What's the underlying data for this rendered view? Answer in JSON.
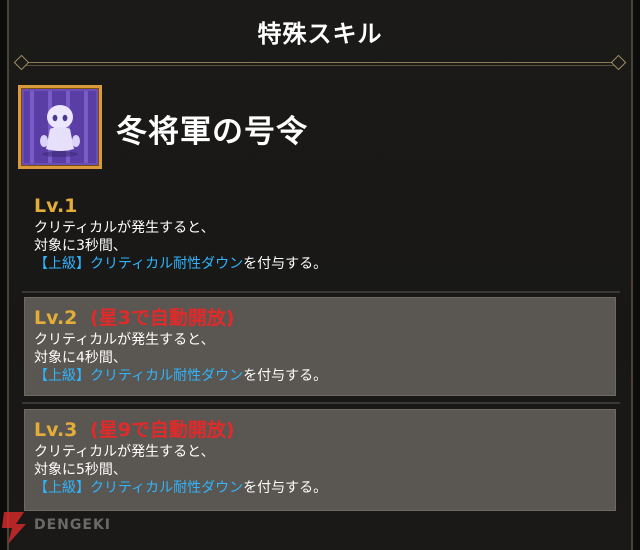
{
  "header": {
    "title": "特殊スキル"
  },
  "skill": {
    "name": "冬将軍の号令",
    "icon": "snowman-ghost-icon"
  },
  "levels": [
    {
      "level": "Lv.1",
      "condition": "",
      "line1": "クリティカルが発生すると、",
      "line2": "対象に3秒間、",
      "keyword": "【上級】クリティカル耐性ダウン",
      "suffix": "を付与する。"
    },
    {
      "level": "Lv.2",
      "condition": "(星3で自動開放)",
      "line1": "クリティカルが発生すると、",
      "line2": "対象に4秒間、",
      "keyword": "【上級】クリティカル耐性ダウン",
      "suffix": "を付与する。"
    },
    {
      "level": "Lv.3",
      "condition": "(星9で自動開放)",
      "line1": "クリティカルが発生すると、",
      "line2": "対象に5秒間、",
      "keyword": "【上級】クリティカル耐性ダウン",
      "suffix": "を付与する。"
    }
  ],
  "watermark": {
    "text": "DENGEKI"
  },
  "colors": {
    "level_gold": "#e3ad3a",
    "condition_red": "#e22a2a",
    "keyword_blue": "#2fb6ff",
    "icon_border": "#d99a3a",
    "locked_box": "#5a5651"
  }
}
